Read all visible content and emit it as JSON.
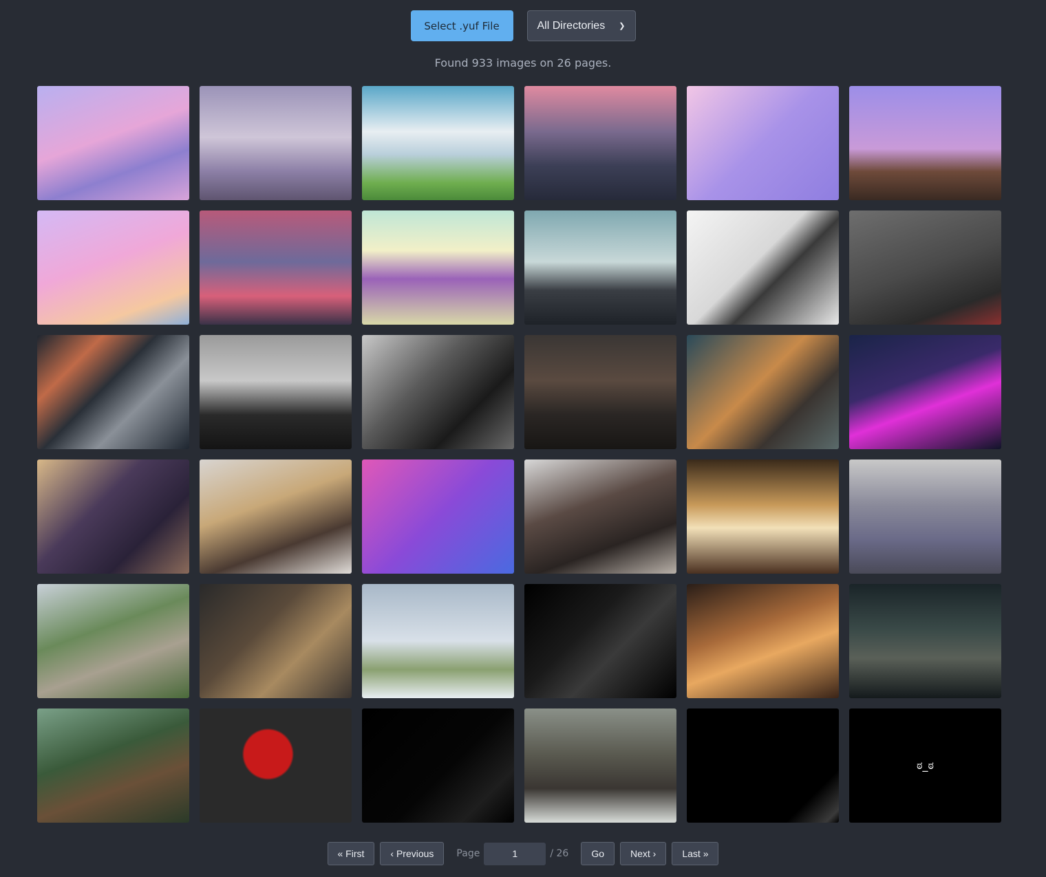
{
  "toolbar": {
    "select_file_label": "Select .yuf File",
    "directory_select": {
      "selected": "All Directories"
    }
  },
  "status_text": "Found 933 images on 26 pages.",
  "thumbnails": [
    {
      "bg": "linear-gradient(160deg,#b9b0f0 0%,#e6a6d8 45%,#8d7fcf 70%,#d8a3d9 100%)",
      "glyph": ""
    },
    {
      "bg": "linear-gradient(180deg,#9b93b8 0%,#cfc6d8 45%,#8c7fa6 75%,#5f5570 100%)",
      "glyph": ""
    },
    {
      "bg": "linear-gradient(180deg,#5aa7c8 0%,#e8eef2 40%,#b9cfdb 60%,#6fae4f 85%,#4b8a3a 100%)",
      "glyph": ""
    },
    {
      "bg": "linear-gradient(180deg,#e08aa0 0%,#7a6a8e 40%,#3c3f56 70%,#262a3a 100%)",
      "glyph": ""
    },
    {
      "bg": "linear-gradient(135deg,#f2c6e6 0%,#a892e8 50%,#8f7ee0 100%)",
      "glyph": ""
    },
    {
      "bg": "linear-gradient(180deg,#9c8ee8 0%,#c99ad8 55%,#6e4a3a 75%,#3a2a22 100%)",
      "glyph": ""
    },
    {
      "bg": "linear-gradient(160deg,#d4b9f5 0%,#f0a8d8 45%,#f5c8a0 80%,#8fb0d8 100%)",
      "glyph": ""
    },
    {
      "bg": "linear-gradient(180deg,#b85a7a 0%,#6e6a9a 45%,#d8607a 75%,#3a3248 100%)",
      "glyph": ""
    },
    {
      "bg": "linear-gradient(180deg,#bfe6d6 0%,#f2f0c8 35%,#9a62b8 60%,#d8d8a8 100%)",
      "glyph": ""
    },
    {
      "bg": "linear-gradient(180deg,#7fa8b0 0%,#c8d8d8 45%,#3a3e44 70%,#1e2228 100%)",
      "glyph": ""
    },
    {
      "bg": "linear-gradient(135deg,#f4f4f4 0%,#d8d8d8 45%,#3a3a3a 60%,#e8e8e8 100%)",
      "glyph": ""
    },
    {
      "bg": "linear-gradient(160deg,#6e6e6e 0%,#4a4a4a 50%,#2a2a2a 80%,#8a3030 100%)",
      "glyph": ""
    },
    {
      "bg": "linear-gradient(135deg,#1e2630 0%,#c06a48 25%,#2a3038 45%,#8a9098 65%,#1e2630 100%)",
      "glyph": ""
    },
    {
      "bg": "linear-gradient(180deg,#9a9a9a 0%,#c8c8c8 40%,#2a2a2a 70%,#141414 100%)",
      "glyph": ""
    },
    {
      "bg": "linear-gradient(135deg,#c8c8c8 0%,#5a5a5a 40%,#1a1a1a 70%,#6a6a6a 100%)",
      "glyph": ""
    },
    {
      "bg": "linear-gradient(180deg,#3a3634 0%,#5a4a40 40%,#2a2624 70%,#181614 100%)",
      "glyph": ""
    },
    {
      "bg": "linear-gradient(135deg,#2a4a5a 0%,#c88a4a 45%,#3a3430 70%,#5a6a6a 100%)",
      "glyph": ""
    },
    {
      "bg": "linear-gradient(160deg,#1a2448 0%,#3a2a6a 40%,#e030d8 60%,#101428 100%)",
      "glyph": ""
    },
    {
      "bg": "linear-gradient(135deg,#d8b888 0%,#4a3a5a 40%,#2a2238 70%,#8a6a5a 100%)",
      "glyph": ""
    },
    {
      "bg": "linear-gradient(160deg,#d8d4d0 0%,#c8a878 40%,#4a3a32 70%,#e0dcd8 100%)",
      "glyph": ""
    },
    {
      "bg": "linear-gradient(135deg,#e058b8 0%,#8a4ad8 50%,#4a6ae0 100%)",
      "glyph": ""
    },
    {
      "bg": "linear-gradient(160deg,#d8d8d8 0%,#5a4a44 40%,#2a2422 70%,#b8b0a8 100%)",
      "glyph": ""
    },
    {
      "bg": "linear-gradient(180deg,#3a2a1a 0%,#c89a5a 40%,#f2e0b8 60%,#4a3020 100%)",
      "glyph": ""
    },
    {
      "bg": "linear-gradient(180deg,#c8c8c8 0%,#8a8a9a 40%,#6a6a88 70%,#4a4a58 100%)",
      "glyph": ""
    },
    {
      "bg": "linear-gradient(160deg,#c8d0d8 0%,#6a8a5a 40%,#a8a090 65%,#4a6a3a 100%)",
      "glyph": ""
    },
    {
      "bg": "linear-gradient(135deg,#2a2a2a 0%,#5a4a3a 40%,#a88a60 65%,#3a3430 100%)",
      "glyph": ""
    },
    {
      "bg": "linear-gradient(180deg,#a8b8c8 0%,#d8e0e8 50%,#8aa070 75%,#e8eef2 100%)",
      "glyph": ""
    },
    {
      "bg": "linear-gradient(135deg,#000000 0%,#1a1a1a 40%,#3a3a3a 60%,#000000 100%)",
      "glyph": ""
    },
    {
      "bg": "linear-gradient(160deg,#2a1e18 0%,#a86a3a 40%,#e8a860 60%,#3a2418 100%)",
      "glyph": ""
    },
    {
      "bg": "linear-gradient(180deg,#1a2428 0%,#3a4a48 40%,#5a6058 65%,#141a1c 100%)",
      "glyph": ""
    },
    {
      "bg": "linear-gradient(160deg,#7aa088 0%,#3a5a3a 40%,#6a5038 65%,#2a3a28 100%)",
      "glyph": ""
    },
    {
      "bg": "radial-gradient(circle at 45% 40%,#c81a1a 0%,#c81a1a 22%,#2a2a2a 24%,#2a2a2a 100%)",
      "glyph": ""
    },
    {
      "bg": "linear-gradient(135deg,#000000 0%,#050505 55%,#1e1e1e 80%,#000000 100%)",
      "glyph": ""
    },
    {
      "bg": "linear-gradient(180deg,#8a9088 0%,#5a5a50 40%,#3a3632 70%,#d8dcd8 100%)",
      "glyph": ""
    },
    {
      "bg": "linear-gradient(135deg,#000000 0%,#000000 80%,#3a3a3a 95%,#000000 100%)",
      "glyph": ""
    },
    {
      "bg": "#000000",
      "glyph": "ಠ_ಠ"
    }
  ],
  "pagination": {
    "first_label": "« First",
    "previous_label": "‹ Previous",
    "page_label": "Page",
    "current_page": "1",
    "total_label": "/ 26",
    "go_label": "Go",
    "next_label": "Next ›",
    "last_label": "Last »"
  }
}
